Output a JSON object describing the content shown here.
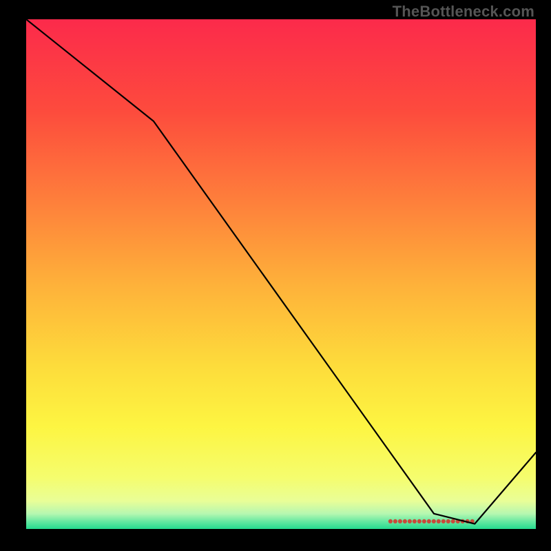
{
  "watermark": "TheBottleneck.com",
  "chart_data": {
    "type": "line",
    "title": "",
    "xlabel": "",
    "ylabel": "",
    "ylim": [
      0,
      100
    ],
    "xlim": [
      0,
      100
    ],
    "x": [
      0,
      25,
      80,
      88,
      100
    ],
    "values": [
      100,
      80,
      3,
      1,
      15
    ],
    "annotations": [
      {
        "text_key": "marker_label",
        "x": 84,
        "y": 1.5
      }
    ],
    "marker_label": "",
    "background_gradient": {
      "stops": [
        {
          "offset": 0.0,
          "color": "#fc2a4b"
        },
        {
          "offset": 0.18,
          "color": "#fd4b3d"
        },
        {
          "offset": 0.36,
          "color": "#fe803b"
        },
        {
          "offset": 0.52,
          "color": "#feb13a"
        },
        {
          "offset": 0.68,
          "color": "#fddc3b"
        },
        {
          "offset": 0.8,
          "color": "#fdf542"
        },
        {
          "offset": 0.9,
          "color": "#f5fd6e"
        },
        {
          "offset": 0.945,
          "color": "#e9fe97"
        },
        {
          "offset": 0.97,
          "color": "#b6f7b0"
        },
        {
          "offset": 0.985,
          "color": "#68e9a2"
        },
        {
          "offset": 1.0,
          "color": "#25db8f"
        }
      ]
    },
    "marker_band": {
      "x0": 71,
      "x1": 88,
      "y": 1.5,
      "color": "#c94a3a"
    }
  }
}
